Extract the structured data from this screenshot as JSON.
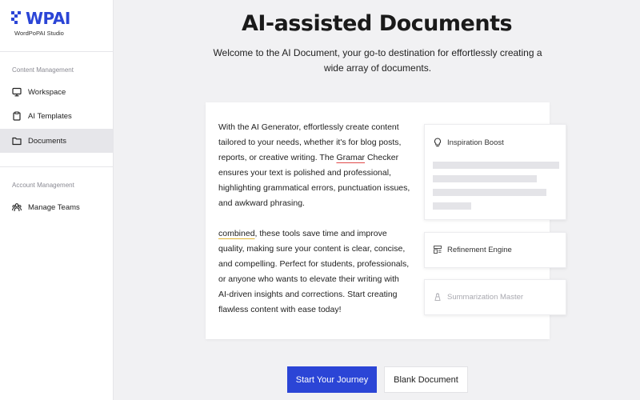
{
  "brand": {
    "name": "WPAI",
    "subtitle": "WordPoPAI Studio"
  },
  "sidebar": {
    "sections": [
      {
        "label": "Content Management"
      },
      {
        "label": "Account Management"
      }
    ],
    "items": [
      {
        "label": "Workspace",
        "icon": "monitor-icon"
      },
      {
        "label": "AI Templates",
        "icon": "clipboard-icon"
      },
      {
        "label": "Documents",
        "icon": "folder-icon",
        "active": true
      },
      {
        "label": "Manage Teams",
        "icon": "team-icon"
      }
    ]
  },
  "main": {
    "title": "AI-assisted Documents",
    "subtitle": "Welcome to the AI Document, your go-to destination for effortlessly creating a wide array of documents.",
    "card": {
      "p1_a": "With the AI Generator, effortlessly create content tailored to your needs, whether it's for blog posts, reports, or creative writing. The ",
      "p1_err": "Gramar",
      "p1_b": " Checker ensures your text is polished and professional, highlighting grammatical errors, punctuation issues, and awkward phrasing.",
      "p2_hl": "combined",
      "p2_b": ", these tools save time and improve quality, making sure your content is clear, concise, and compelling. Perfect for students, professionals, or anyone who wants to elevate their writing with AI-driven insights and corrections. Start creating flawless content with ease today!"
    },
    "features": [
      {
        "label": "Inspiration Boost",
        "icon": "lightbulb-icon"
      },
      {
        "label": "Refinement Engine",
        "icon": "refine-icon"
      },
      {
        "label": "Summarization Master",
        "icon": "summary-icon"
      }
    ],
    "buttons": {
      "primary": "Start Your Journey",
      "secondary": "Blank Document"
    }
  },
  "colors": {
    "accent": "#2b45d6",
    "error_underline": "#e04a4a",
    "highlight_underline": "#e2b533"
  }
}
